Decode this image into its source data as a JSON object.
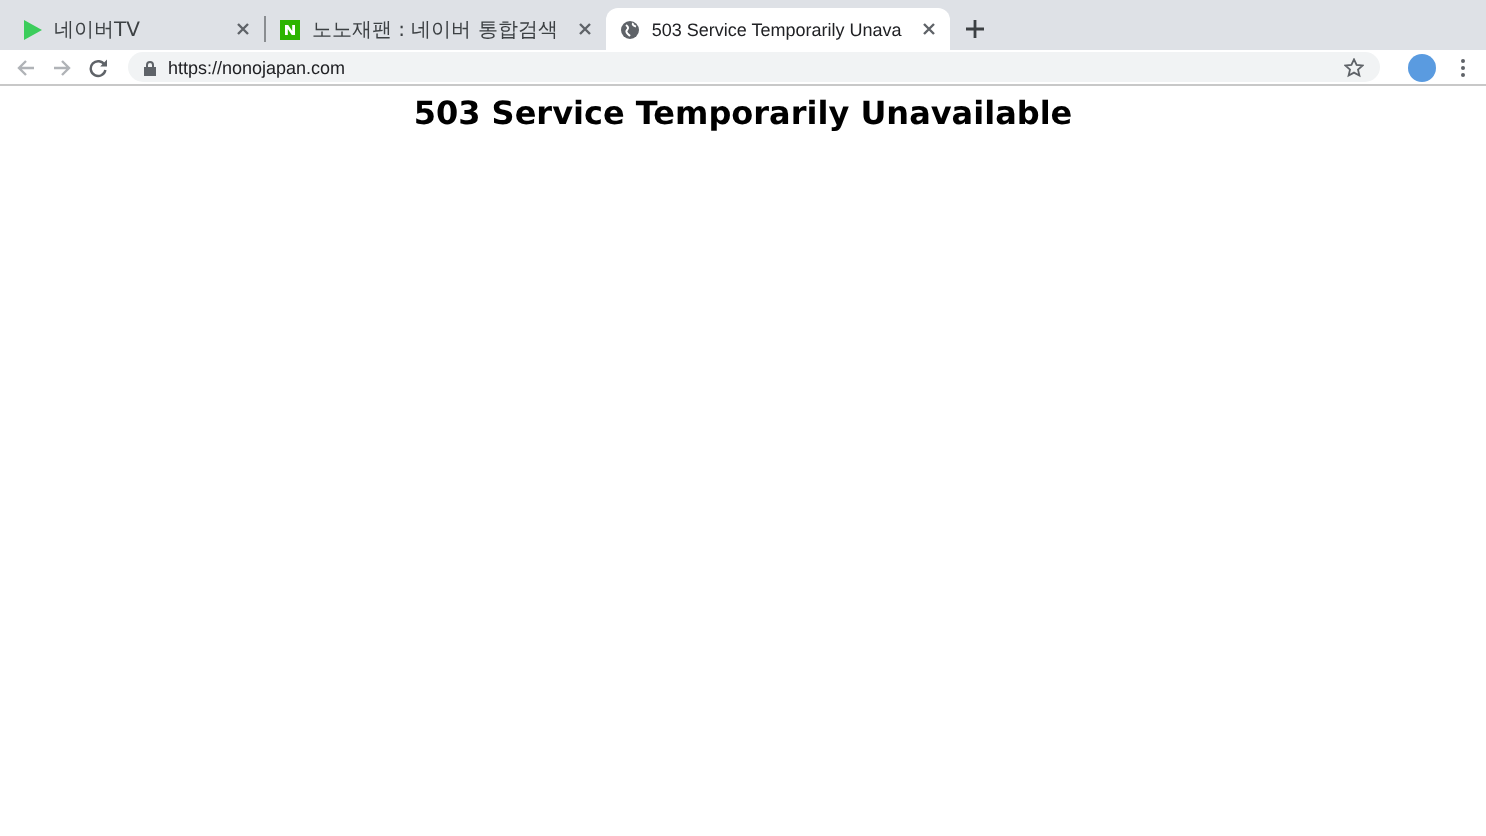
{
  "tabs": [
    {
      "label": "네이버TV",
      "selected": false,
      "kind": "play"
    },
    {
      "label": "노노재팬 : 네이버 통합검색",
      "selected": false,
      "kind": "naver"
    },
    {
      "label": "503 Service Temporarily Unava",
      "selected": true,
      "kind": "globe"
    }
  ],
  "address_bar": {
    "url": "https://nonojapan.com"
  },
  "page": {
    "heading": "503 Service Temporarily Unavailable"
  }
}
